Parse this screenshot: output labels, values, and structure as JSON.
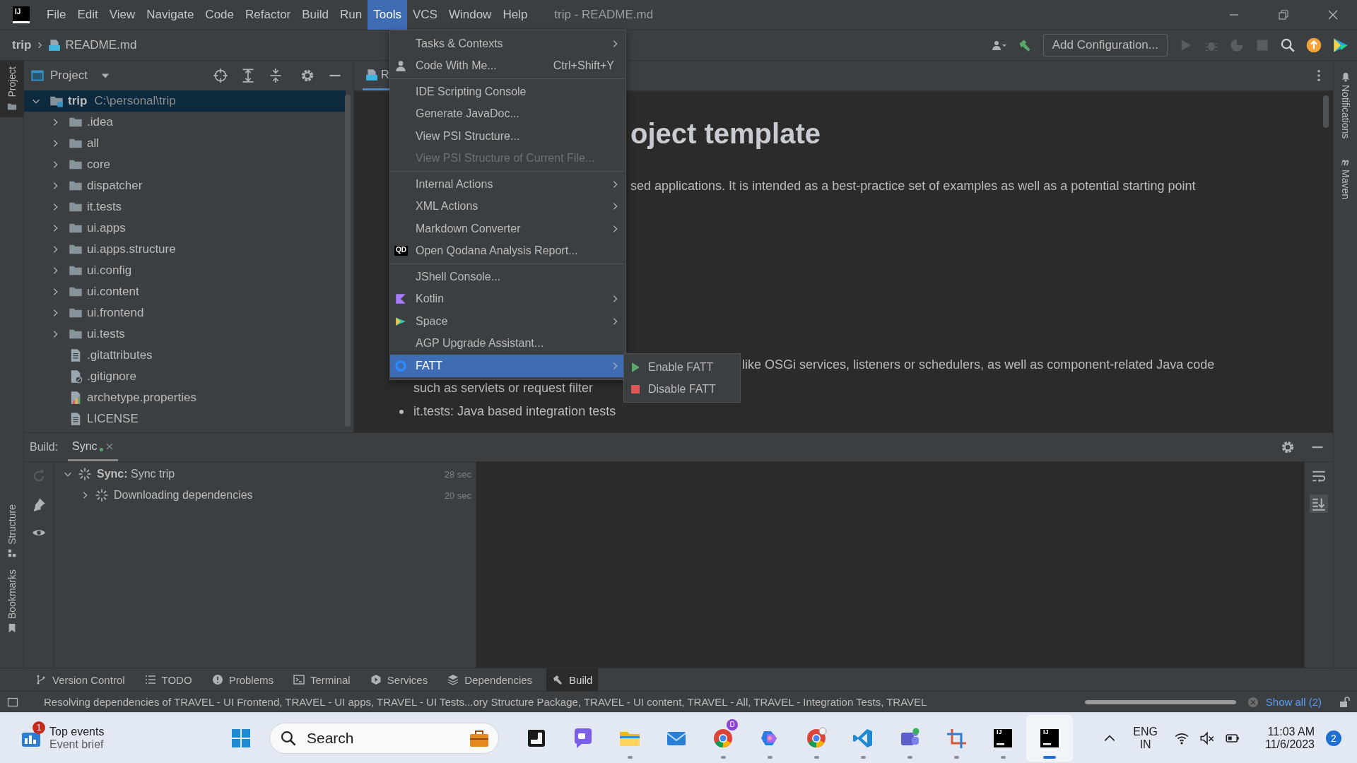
{
  "title_bar": {
    "logo": "IJ",
    "menu": [
      {
        "label": "File",
        "selected": false
      },
      {
        "label": "Edit",
        "selected": false
      },
      {
        "label": "View",
        "selected": false
      },
      {
        "label": "Navigate",
        "selected": false
      },
      {
        "label": "Code",
        "selected": false
      },
      {
        "label": "Refactor",
        "selected": false
      },
      {
        "label": "Build",
        "selected": false
      },
      {
        "label": "Run",
        "selected": false
      },
      {
        "label": "Tools",
        "selected": true
      },
      {
        "label": "VCS",
        "selected": false
      },
      {
        "label": "Window",
        "selected": false
      },
      {
        "label": "Help",
        "selected": false
      }
    ],
    "title": "trip - README.md"
  },
  "nav_bar": {
    "breadcrumbs": [
      "trip",
      "README.md"
    ],
    "run_configuration": "Add Configuration..."
  },
  "tools_menu": {
    "items": [
      {
        "kind": "item",
        "label": "Tasks & Contexts",
        "has_submenu": true,
        "disabled": false,
        "selected": false
      },
      {
        "kind": "item",
        "label": "Code With Me...",
        "shortcut": "Ctrl+Shift+Y",
        "has_submenu": false,
        "disabled": false,
        "selected": false
      },
      {
        "kind": "separator"
      },
      {
        "kind": "item",
        "label": "IDE Scripting Console",
        "has_submenu": false,
        "disabled": false,
        "selected": false
      },
      {
        "kind": "item",
        "label": "Generate JavaDoc...",
        "has_submenu": false,
        "disabled": false,
        "selected": false
      },
      {
        "kind": "item",
        "label": "View PSI Structure...",
        "has_submenu": false,
        "disabled": false,
        "selected": false
      },
      {
        "kind": "item",
        "label": "View PSI Structure of Current File...",
        "has_submenu": false,
        "disabled": true,
        "selected": false
      },
      {
        "kind": "separator"
      },
      {
        "kind": "item",
        "label": "Internal Actions",
        "has_submenu": true,
        "disabled": false,
        "selected": false
      },
      {
        "kind": "item",
        "label": "XML Actions",
        "has_submenu": true,
        "disabled": false,
        "selected": false
      },
      {
        "kind": "item",
        "label": "Markdown Converter",
        "has_submenu": true,
        "disabled": false,
        "selected": false
      },
      {
        "kind": "item",
        "label": "Open Qodana Analysis Report...",
        "badge": "QD",
        "has_submenu": false,
        "disabled": false,
        "selected": false
      },
      {
        "kind": "separator"
      },
      {
        "kind": "item",
        "label": "JShell Console...",
        "has_submenu": false,
        "disabled": false,
        "selected": false
      },
      {
        "kind": "item",
        "label": "Kotlin",
        "has_submenu": true,
        "disabled": false,
        "selected": false
      },
      {
        "kind": "item",
        "label": "Space",
        "has_submenu": true,
        "disabled": false,
        "selected": false
      },
      {
        "kind": "item",
        "label": "AGP Upgrade Assistant...",
        "has_submenu": false,
        "disabled": false,
        "selected": false
      },
      {
        "kind": "item",
        "label": "FATT",
        "has_submenu": true,
        "disabled": false,
        "selected": true
      }
    ]
  },
  "fatt_submenu": {
    "items": [
      {
        "kind": "enable",
        "label": "Enable FATT"
      },
      {
        "kind": "disable",
        "label": "Disable FATT"
      }
    ]
  },
  "left_strip": [
    {
      "label": "Project",
      "selected": true
    },
    {
      "label": "Structure",
      "selected": false
    },
    {
      "label": "Bookmarks",
      "selected": false
    }
  ],
  "right_strip": [
    "Notifications",
    "Maven"
  ],
  "project_panel": {
    "title": "Project",
    "tree": [
      {
        "kind": "root",
        "name": "trip",
        "path": "C:\\personal\\trip",
        "expanded": true,
        "selected": true,
        "children": [
          {
            "kind": "folder",
            "name": ".idea",
            "expanded": false,
            "selected": false
          },
          {
            "kind": "folder",
            "name": "all",
            "expanded": false,
            "selected": false
          },
          {
            "kind": "folder",
            "name": "core",
            "expanded": false,
            "selected": false
          },
          {
            "kind": "folder",
            "name": "dispatcher",
            "expanded": false,
            "selected": false
          },
          {
            "kind": "folder",
            "name": "it.tests",
            "expanded": false,
            "selected": false
          },
          {
            "kind": "folder",
            "name": "ui.apps",
            "expanded": false,
            "selected": false
          },
          {
            "kind": "folder",
            "name": "ui.apps.structure",
            "expanded": false,
            "selected": false
          },
          {
            "kind": "folder",
            "name": "ui.config",
            "expanded": false,
            "selected": false
          },
          {
            "kind": "folder",
            "name": "ui.content",
            "expanded": false,
            "selected": false
          },
          {
            "kind": "folder",
            "name": "ui.frontend",
            "expanded": false,
            "selected": false
          },
          {
            "kind": "folder",
            "name": "ui.tests",
            "expanded": false,
            "selected": false
          },
          {
            "kind": "text-file",
            "name": ".gitattributes",
            "selected": false
          },
          {
            "kind": "ignore-file",
            "name": ".gitignore",
            "selected": false
          },
          {
            "kind": "properties-file",
            "name": "archetype.properties",
            "selected": false
          },
          {
            "kind": "text-file",
            "name": "LICENSE",
            "selected": false
          }
        ]
      }
    ]
  },
  "editor": {
    "tab": "R",
    "blocks": [
      {
        "kind": "heading",
        "lines": [
          {
            "right": "oject template"
          }
        ]
      },
      {
        "kind": "paragraph",
        "lines": [
          {
            "right": "sed applications. It is intended as a best-practice set of examples as well as a potential starting point"
          }
        ]
      },
      {
        "kind": "bullets",
        "lines": [
          {
            "right": "like OSGi services, listeners or schedulers, as well as component-related Java code"
          },
          {
            "left": "such as servlets or request filter"
          },
          {
            "bullet": true,
            "left": "it.tests: Java based integration tests"
          }
        ]
      }
    ]
  },
  "build_panel": {
    "label": "Build:",
    "tabs": [
      {
        "label": "Sync",
        "selected": true
      }
    ],
    "tree": [
      {
        "label": "**Sync:** Sync trip",
        "time": "28 sec",
        "expanded": true,
        "children": [
          {
            "label": "Downloading dependencies",
            "time": "20 sec",
            "expanded": false
          }
        ]
      }
    ]
  },
  "tool_tabs": [
    {
      "label": "Version Control",
      "selected": false
    },
    {
      "label": "TODO",
      "selected": false
    },
    {
      "label": "Problems",
      "selected": false
    },
    {
      "label": "Terminal",
      "selected": false
    },
    {
      "label": "Services",
      "selected": false
    },
    {
      "label": "Dependencies",
      "selected": false
    },
    {
      "label": "Build",
      "selected": true
    }
  ],
  "status_bar": {
    "message": "Resolving dependencies of TRAVEL - UI Frontend, TRAVEL - UI apps, TRAVEL - UI Tests...ory Structure Package, TRAVEL - UI content, TRAVEL - All, TRAVEL - Integration Tests, TRAVEL",
    "link": "Show all (2)",
    "progress": {
      "level": 1
    }
  },
  "taskbar": {
    "widget": {
      "badge": "1",
      "title": "Top events",
      "subtitle": "Event brief"
    },
    "search": {
      "placeholder": "Search"
    },
    "apps": [
      {
        "running": false,
        "active": false
      },
      {
        "running": false,
        "active": false
      },
      {
        "running": true,
        "active": false
      },
      {
        "running": false,
        "active": false
      },
      {
        "running": true,
        "active": false,
        "badge": "D"
      },
      {
        "running": true,
        "active": false
      },
      {
        "running": true,
        "active": false
      },
      {
        "running": true,
        "active": false
      },
      {
        "running": true,
        "active": false
      },
      {
        "running": true,
        "active": false
      },
      {
        "running": true,
        "active": false,
        "logo": "IJ"
      },
      {
        "running": true,
        "active": true,
        "logo": "IJ"
      }
    ],
    "tray": {
      "language": "ENG",
      "region": "IN",
      "time": "11:03 AM",
      "date": "11/6/2023",
      "notifications": "2"
    }
  }
}
